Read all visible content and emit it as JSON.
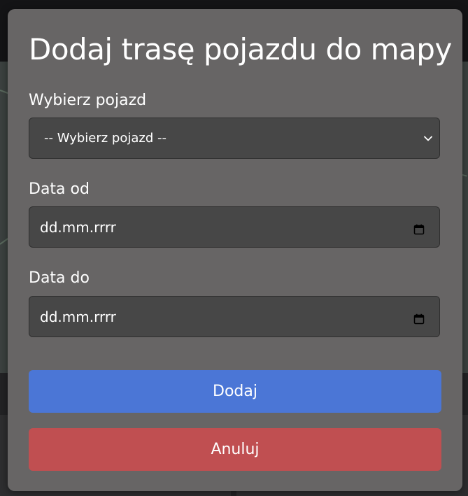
{
  "modal": {
    "title": "Dodaj trasę pojazdu do mapy",
    "vehicle": {
      "label": "Wybierz pojazd",
      "selected": "-- Wybierz pojazd --"
    },
    "date_from": {
      "label": "Data od",
      "value": "dd.mm.rrrr"
    },
    "date_to": {
      "label": "Data do",
      "value": "dd.mm.rrrr"
    },
    "add_label": "Dodaj",
    "cancel_label": "Anuluj"
  },
  "colors": {
    "modal_bg": "#676565",
    "control_bg": "#474747",
    "primary": "#4b76d6",
    "danger": "#c04f51"
  },
  "icons": {
    "select_arrow": "chevron-down-icon",
    "date_picker": "calendar-icon"
  }
}
